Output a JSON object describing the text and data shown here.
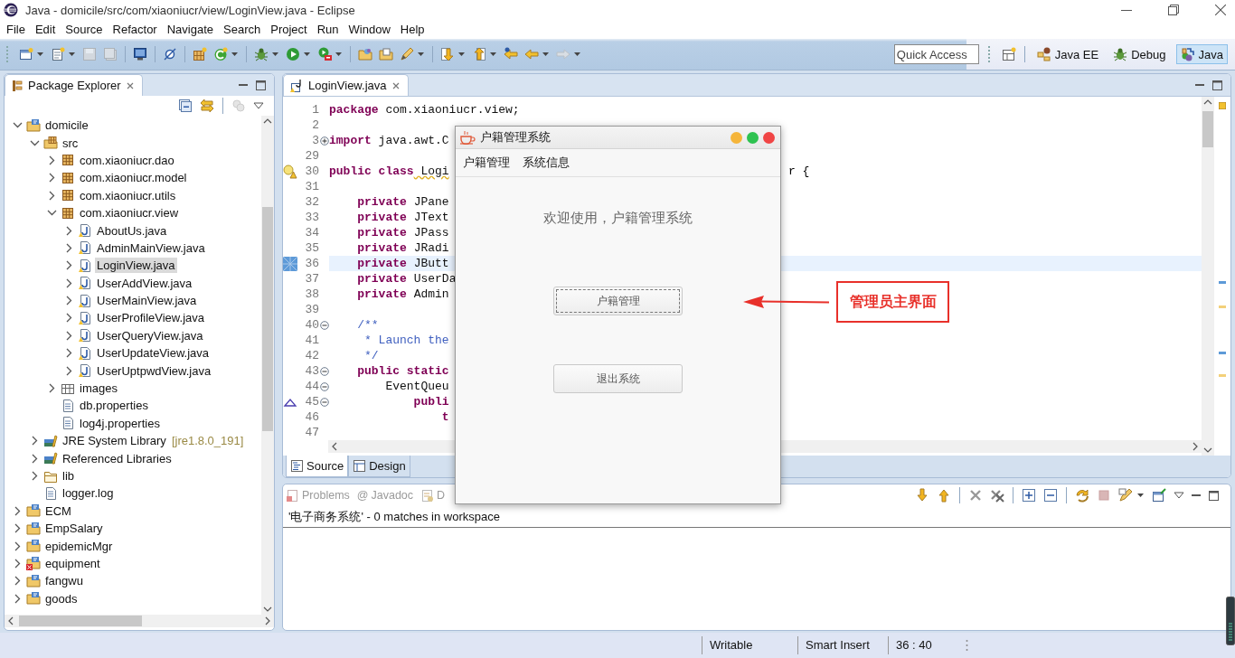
{
  "window": {
    "title": "Java - domicile/src/com/xiaoniucr/view/LoginView.java - Eclipse"
  },
  "menu": [
    "File",
    "Edit",
    "Source",
    "Refactor",
    "Navigate",
    "Search",
    "Project",
    "Run",
    "Window",
    "Help"
  ],
  "toolbar": {
    "quick_access": {
      "placeholder": "Quick Access"
    },
    "perspectives": [
      {
        "label": "Java EE",
        "kind": "javaee",
        "selected": false
      },
      {
        "label": "Debug",
        "kind": "debug",
        "selected": false
      },
      {
        "label": "Java",
        "kind": "java",
        "selected": true
      }
    ]
  },
  "package_explorer": {
    "title": "Package Explorer",
    "tree": [
      {
        "label": "domicile",
        "kind": "project",
        "expanded": true,
        "selected": false,
        "children": [
          {
            "label": "src",
            "kind": "sourcefolder",
            "expanded": true,
            "selected": false,
            "children": [
              {
                "label": "com.xiaoniucr.dao",
                "kind": "package",
                "expanded": false,
                "selected": false
              },
              {
                "label": "com.xiaoniucr.model",
                "kind": "package",
                "expanded": false,
                "selected": false
              },
              {
                "label": "com.xiaoniucr.utils",
                "kind": "package",
                "expanded": false,
                "selected": false
              },
              {
                "label": "com.xiaoniucr.view",
                "kind": "package",
                "expanded": true,
                "selected": false,
                "children": [
                  {
                    "label": "AboutUs.java",
                    "kind": "javafile",
                    "expanded": false,
                    "selected": false
                  },
                  {
                    "label": "AdminMainView.java",
                    "kind": "javafile",
                    "expanded": false,
                    "selected": false
                  },
                  {
                    "label": "LoginView.java",
                    "kind": "javafile",
                    "expanded": false,
                    "selected": true
                  },
                  {
                    "label": "UserAddView.java",
                    "kind": "javafile",
                    "expanded": false,
                    "selected": false
                  },
                  {
                    "label": "UserMainView.java",
                    "kind": "javafile",
                    "expanded": false,
                    "selected": false
                  },
                  {
                    "label": "UserProfileView.java",
                    "kind": "javafile",
                    "expanded": false,
                    "selected": false
                  },
                  {
                    "label": "UserQueryView.java",
                    "kind": "javafile",
                    "expanded": false,
                    "selected": false
                  },
                  {
                    "label": "UserUpdateView.java",
                    "kind": "javafile",
                    "expanded": false,
                    "selected": false
                  },
                  {
                    "label": "UserUptpwdView.java",
                    "kind": "javafile",
                    "expanded": false,
                    "selected": false
                  }
                ]
              },
              {
                "label": "images",
                "kind": "imagefolder",
                "expanded": false,
                "selected": false
              },
              {
                "label": "db.properties",
                "kind": "textfile",
                "selected": false
              },
              {
                "label": "log4j.properties",
                "kind": "textfile",
                "selected": false
              }
            ]
          },
          {
            "label": "JRE System Library",
            "decoration": "[jre1.8.0_191]",
            "kind": "library",
            "expanded": false,
            "selected": false
          },
          {
            "label": "Referenced Libraries",
            "kind": "library",
            "expanded": false,
            "selected": false
          },
          {
            "label": "lib",
            "kind": "folder",
            "expanded": false,
            "selected": false
          },
          {
            "label": "logger.log",
            "kind": "textfile",
            "selected": false
          }
        ]
      },
      {
        "label": "ECM",
        "kind": "project",
        "expanded": false,
        "selected": false
      },
      {
        "label": "EmpSalary",
        "kind": "project",
        "expanded": false,
        "selected": false
      },
      {
        "label": "epidemicMgr",
        "kind": "project",
        "expanded": false,
        "selected": false
      },
      {
        "label": "equipment",
        "kind": "project",
        "expanded": false,
        "selected": false,
        "error": true
      },
      {
        "label": "fangwu",
        "kind": "project",
        "expanded": false,
        "selected": false
      },
      {
        "label": "goods",
        "kind": "project",
        "expanded": false,
        "selected": false
      }
    ]
  },
  "editor": {
    "tabs": [
      {
        "label": "LoginView.java",
        "selected": true
      }
    ],
    "lines": [
      {
        "number": "1",
        "segments": [
          {
            "kind": "keyword",
            "text": "package"
          },
          {
            "kind": "plain",
            "text": " com.xiaoniucr.view;"
          }
        ]
      },
      {
        "number": "2"
      },
      {
        "number": "3",
        "fold": {
          "expanded": false
        },
        "segments": [
          {
            "kind": "keyword",
            "text": "import"
          },
          {
            "kind": "plain",
            "text": " java.awt.C"
          }
        ]
      },
      {
        "number": "29"
      },
      {
        "number": "30",
        "marker": {
          "kind": "warning"
        },
        "segments": [
          {
            "kind": "keyword",
            "text": "public class"
          },
          {
            "kind": "warning",
            "text": " Logi"
          }
        ],
        "tail": "r {"
      },
      {
        "number": "31"
      },
      {
        "number": "32",
        "segments": [
          {
            "kind": "keyword",
            "text": "    private"
          },
          {
            "kind": "plain",
            "text": " JPane"
          }
        ]
      },
      {
        "number": "33",
        "segments": [
          {
            "kind": "keyword",
            "text": "    private"
          },
          {
            "kind": "plain",
            "text": " JText"
          }
        ]
      },
      {
        "number": "34",
        "segments": [
          {
            "kind": "keyword",
            "text": "    private"
          },
          {
            "kind": "plain",
            "text": " JPass"
          }
        ]
      },
      {
        "number": "35",
        "segments": [
          {
            "kind": "keyword",
            "text": "    private"
          },
          {
            "kind": "plain",
            "text": " JRadi"
          }
        ]
      },
      {
        "number": "36",
        "marker": {
          "kind": "current"
        },
        "highlighted": true,
        "segments": [
          {
            "kind": "keyword",
            "text": "    private"
          },
          {
            "kind": "plain",
            "text": " JButt"
          }
        ]
      },
      {
        "number": "37",
        "segments": [
          {
            "kind": "keyword",
            "text": "    private"
          },
          {
            "kind": "plain",
            "text": " UserDa"
          }
        ]
      },
      {
        "number": "38",
        "segments": [
          {
            "kind": "keyword",
            "text": "    private"
          },
          {
            "kind": "plain",
            "text": " Admin"
          }
        ]
      },
      {
        "number": "39"
      },
      {
        "number": "40",
        "fold": {
          "expanded": true
        },
        "segments": [
          {
            "kind": "comment",
            "text": "    /**"
          }
        ]
      },
      {
        "number": "41",
        "segments": [
          {
            "kind": "comment",
            "text": "     * Launch the"
          }
        ]
      },
      {
        "number": "42",
        "segments": [
          {
            "kind": "comment",
            "text": "     */"
          }
        ]
      },
      {
        "number": "43",
        "fold": {
          "expanded": true
        },
        "segments": [
          {
            "kind": "keyword",
            "text": "    public static"
          }
        ]
      },
      {
        "number": "44",
        "fold": {
          "expanded": true
        },
        "segments": [
          {
            "kind": "plain",
            "text": "        EventQueu"
          }
        ]
      },
      {
        "number": "45",
        "fold": {
          "expanded": true
        },
        "marker": {
          "kind": "override"
        },
        "segments": [
          {
            "kind": "keyword",
            "text": "            publi"
          }
        ]
      },
      {
        "number": "46",
        "segments": [
          {
            "kind": "keyword",
            "text": "                t"
          }
        ]
      },
      {
        "number": "47"
      }
    ],
    "bottom_tabs": [
      {
        "label": "Source",
        "kind": "source",
        "selected": true
      },
      {
        "label": "Design",
        "kind": "design",
        "selected": false
      }
    ]
  },
  "bottom_panel": {
    "tabs": [
      {
        "label": "Problems",
        "kind": "problems",
        "selected": false
      },
      {
        "label": "Javadoc",
        "kind": "javadoc",
        "symbol": "@",
        "selected": false
      },
      {
        "label": "D",
        "kind": "declaration",
        "selected": false
      }
    ],
    "message": "'电子商务系统' - 0 matches in workspace"
  },
  "dialog": {
    "title": "户籍管理系统",
    "menu": [
      "户籍管理",
      "系统信息"
    ],
    "welcome": "欢迎使用，户籍管理系统",
    "buttons": [
      {
        "label": "户籍管理",
        "focused": true
      },
      {
        "label": "退出系统",
        "focused": false
      }
    ]
  },
  "annotation": {
    "label": "管理员主界面"
  },
  "status_bar": {
    "items": [
      "Writable",
      "Smart Insert",
      "36 : 40"
    ]
  }
}
